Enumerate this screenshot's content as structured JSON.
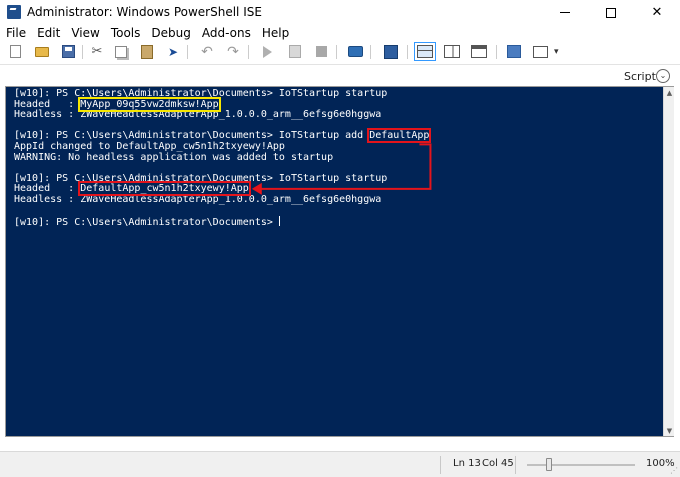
{
  "window": {
    "title": "Administrator: Windows PowerShell ISE",
    "icon": "powershell-icon"
  },
  "menu": [
    "File",
    "Edit",
    "View",
    "Tools",
    "Debug",
    "Add-ons",
    "Help"
  ],
  "toolbar": {
    "icons": [
      "new-file-icon",
      "open-folder-icon",
      "save-icon",
      "cut-icon",
      "copy-icon",
      "paste-icon",
      "clear-console-icon",
      "undo-icon",
      "redo-icon",
      "run-script-icon",
      "run-selection-icon",
      "stop-icon",
      "new-remote-tab-icon",
      "start-powershell-icon",
      "show-script-top-icon",
      "show-script-right-icon",
      "show-script-max-icon",
      "show-command-window-icon",
      "show-command-addon-icon"
    ]
  },
  "script_bar": {
    "label": "Script",
    "toggle_icon": "chevron-down-icon"
  },
  "console": {
    "lines": [
      {
        "parts": [
          {
            "t": "[w10]: PS C:\\Users\\Administrator\\Documents> IoTStartup startup"
          }
        ]
      },
      {
        "parts": [
          {
            "t": "Headed   : "
          },
          {
            "t": "MyApp_09q55vw2dmksw!App",
            "hl": "yellow"
          }
        ]
      },
      {
        "parts": [
          {
            "t": "Headless : ZWaveHeadlessAdapterApp_1.0.0.0_arm__6efsg6e0hggwa"
          }
        ]
      },
      {
        "parts": [
          {
            "t": ""
          }
        ]
      },
      {
        "parts": [
          {
            "t": "[w10]: PS C:\\Users\\Administrator\\Documents> IoTStartup add "
          },
          {
            "t": "DefaultApp",
            "hl": "red"
          }
        ]
      },
      {
        "parts": [
          {
            "t": "AppId changed to DefaultApp_cw5n1h2txyewy!App"
          }
        ]
      },
      {
        "parts": [
          {
            "t": "WARNING: No headless application was added to startup"
          }
        ]
      },
      {
        "parts": [
          {
            "t": ""
          }
        ]
      },
      {
        "parts": [
          {
            "t": "[w10]: PS C:\\Users\\Administrator\\Documents> IoTStartup startup"
          }
        ]
      },
      {
        "parts": [
          {
            "t": "Headed   : "
          },
          {
            "t": "DefaultApp_cw5n1h2txyewy!App",
            "hl": "red"
          }
        ]
      },
      {
        "parts": [
          {
            "t": "Headless : ZWaveHeadlessAdapterApp_1.0.0.0_arm__6efsg6e0hggwa"
          }
        ]
      },
      {
        "parts": [
          {
            "t": ""
          }
        ]
      },
      {
        "parts": [
          {
            "t": "[w10]: PS C:\\Users\\Administrator\\Documents> "
          }
        ],
        "cursor": true
      }
    ],
    "background": "#012456",
    "foreground": "#ffffff",
    "highlight_yellow": "#f7e700",
    "highlight_red": "#e3141b"
  },
  "status": {
    "ln": "Ln 13",
    "col": "Col 45",
    "zoom": "100%",
    "zoom_level": 0.2
  }
}
